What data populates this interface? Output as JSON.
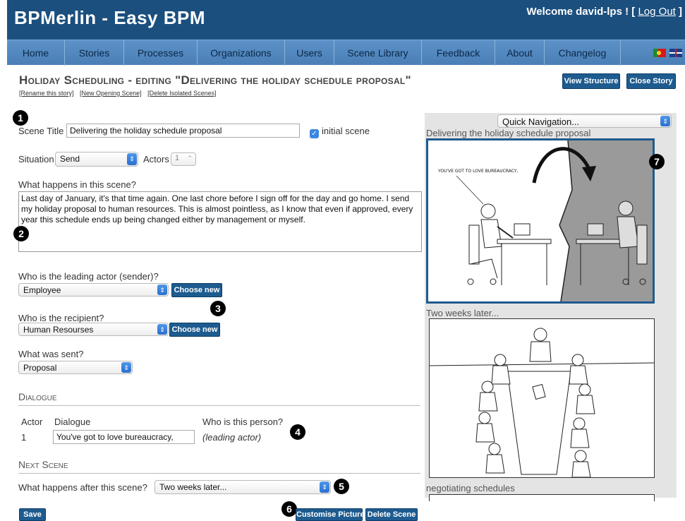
{
  "header": {
    "app_title": "BPMerlin - Easy BPM",
    "welcome_prefix": "Welcome ",
    "username": "david-lps",
    "welcome_suffix": " ! [ ",
    "logout": "Log Out",
    "welcome_end": " ]"
  },
  "nav": {
    "items": [
      "Home",
      "Stories",
      "Processes",
      "Organizations",
      "Users",
      "Scene Library",
      "Feedback",
      "About",
      "Changelog"
    ]
  },
  "page": {
    "title": "Holiday Scheduling - editing \"Delivering the holiday schedule proposal\"",
    "links": [
      "[Rename this story]",
      "[New Opening Scene]",
      "[Delete Isolated Scenes]"
    ],
    "view_structure": "View Structure",
    "close_story": "Close Story"
  },
  "markers": [
    "1",
    "2",
    "3",
    "4",
    "5",
    "6",
    "7"
  ],
  "form": {
    "scene_title_label": "Scene Title",
    "scene_title_value": "Delivering the holiday schedule proposal",
    "initial_scene_label": "initial scene",
    "situation_label": "Situation",
    "situation_value": "Send",
    "actors_label": "Actors",
    "actors_value": "1",
    "what_happens_label": "What happens in this scene?",
    "what_happens_value": "Last day of January, it's that time again. One last chore before I sign off for the day and go home. I send my holiday proposal to human resources. This is almost pointless, as I know that even if approved, every year this schedule ends up being changed either by management or myself.",
    "leading_actor_label": "Who is the leading actor (sender)?",
    "leading_actor_value": "Employee",
    "recipient_label": "Who is the recipient?",
    "recipient_value": "Human Resourses",
    "choose_new": "Choose new",
    "what_sent_label": "What was sent?",
    "what_sent_value": "Proposal"
  },
  "dialogue": {
    "section_title": "Dialogue",
    "columns": [
      "Actor",
      "Dialogue",
      "Who is this person?"
    ],
    "rows": [
      {
        "actor": "1",
        "text": "You've got to love bureaucracy,",
        "person": "(leading actor)"
      }
    ]
  },
  "next_scene": {
    "section_title": "Next Scene",
    "label": "What happens after this scene?",
    "value": "Two weeks later..."
  },
  "buttons": {
    "save": "Save",
    "customise_picture": "Customise Picture",
    "delete_scene": "Delete Scene"
  },
  "right_panel": {
    "quick_nav": "Quick Navigation...",
    "scenes": [
      {
        "caption": "Delivering the holiday schedule proposal",
        "speech": "YOU'VE GOT TO LOVE BUREAUCRACY,"
      },
      {
        "caption": "Two weeks later..."
      },
      {
        "caption": "negotiating schedules"
      }
    ]
  },
  "colors": {
    "header_bg": "#1b4f7e",
    "nav_bg": "#5c92c8",
    "button_bg": "#1e5b8f",
    "selected_scene_border": "#1f5a8e"
  }
}
